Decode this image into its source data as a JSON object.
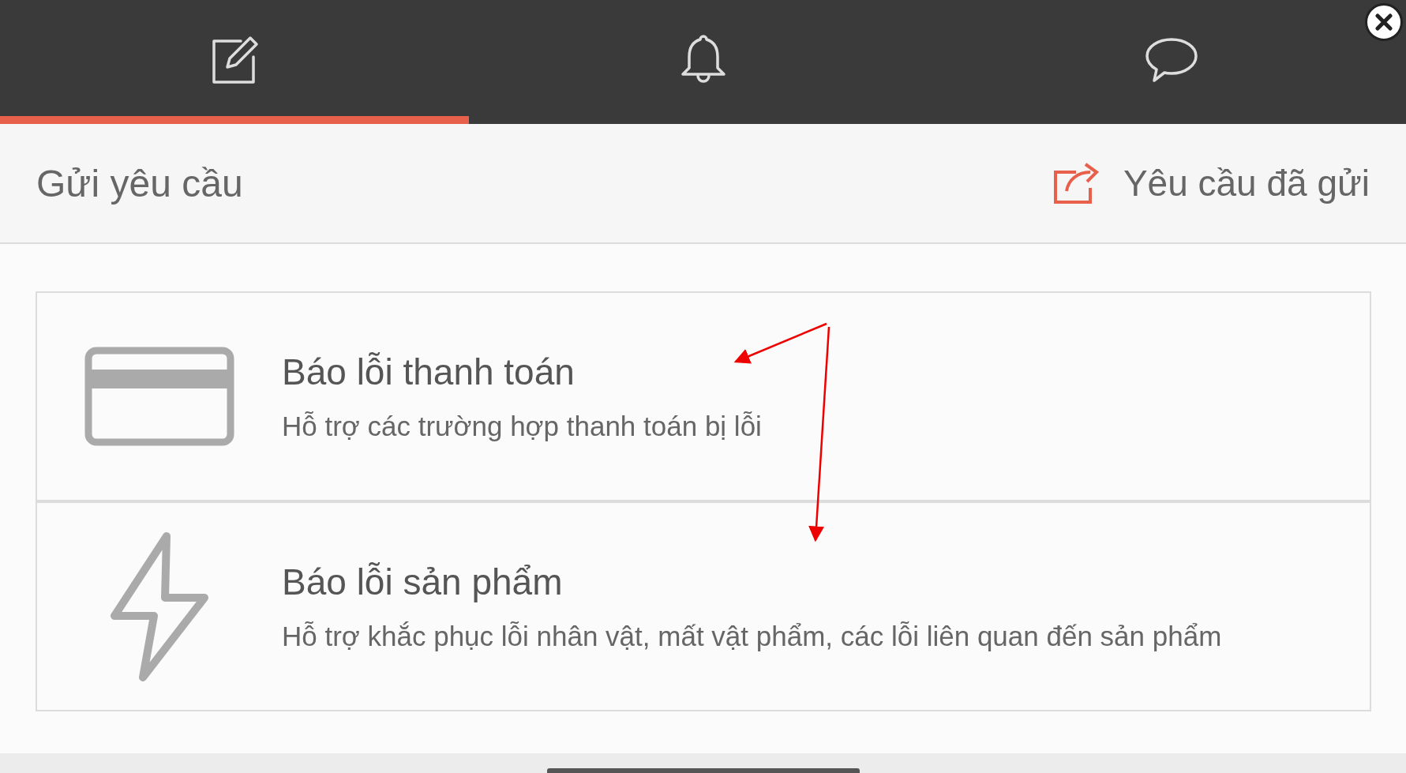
{
  "tabs": [
    {
      "kind": "compose",
      "selected": true
    },
    {
      "kind": "bell",
      "selected": false
    },
    {
      "kind": "chat",
      "selected": false
    }
  ],
  "header": {
    "title": "Gửi yêu cầu",
    "sent_link": "Yêu cầu đã gửi"
  },
  "categories": [
    {
      "kind": "card",
      "title": "Báo lỗi thanh toán",
      "description": "Hỗ trợ các trường hợp thanh toán bị lỗi"
    },
    {
      "kind": "bolt",
      "title": "Báo lỗi sản phẩm",
      "description": "Hỗ trợ khắc phục lỗi nhân vật, mất vật phẩm, các lỗi liên quan đến sản phẩm"
    }
  ]
}
